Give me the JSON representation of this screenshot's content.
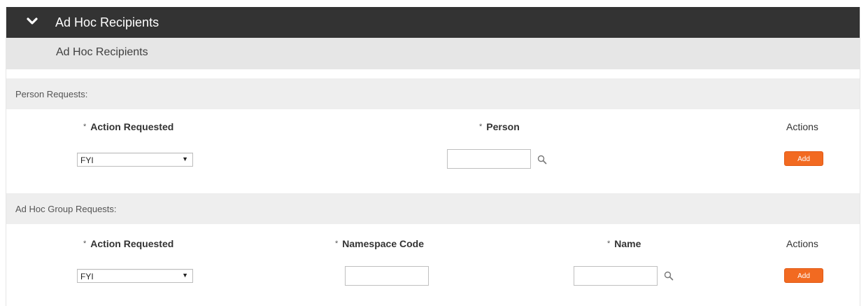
{
  "header": {
    "title": "Ad Hoc Recipients",
    "toggle_icon": "chevron-down-icon"
  },
  "subheader": {
    "title": "Ad Hoc Recipients"
  },
  "person_requests": {
    "section_label": "Person Requests:",
    "action_requested_label": "Action Requested",
    "person_label": "Person",
    "actions_label": "Actions",
    "action_requested_value": "FYI",
    "person_value": "",
    "add_label": "Add"
  },
  "group_requests": {
    "section_label": "Ad Hoc Group Requests:",
    "action_requested_label": "Action Requested",
    "namespace_code_label": "Namespace Code",
    "name_label": "Name",
    "actions_label": "Actions",
    "action_requested_value": "FYI",
    "namespace_code_value": "",
    "name_value": "",
    "add_label": "Add"
  },
  "required_marker": "*",
  "colors": {
    "header_bg": "#333333",
    "accent": "#f26a21",
    "section_bg": "#eeeeee"
  }
}
